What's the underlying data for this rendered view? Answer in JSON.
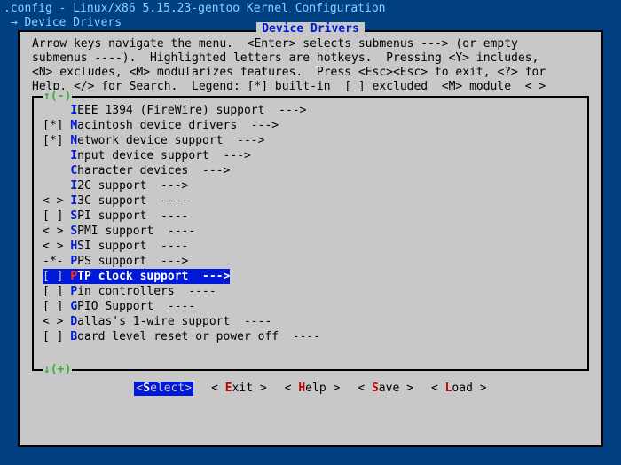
{
  "header": {
    "line1": ".config - Linux/x86 5.15.23-gentoo Kernel Configuration",
    "line2": " → Device Drivers"
  },
  "window": {
    "title": "Device Drivers",
    "help_text": "Arrow keys navigate the menu.  <Enter> selects submenus ---> (or empty\nsubmenus ----).  Highlighted letters are hotkeys.  Pressing <Y> includes,\n<N> excludes, <M> modularizes features.  Press <Esc><Esc> to exit, <?> for\nHelp, </> for Search.  Legend: [*] built-in  [ ] excluded  <M> module  < >",
    "scroll_up": "↑(-)",
    "scroll_down": "↓(+)"
  },
  "items": [
    {
      "mark": "   ",
      "hot": "I",
      "rest": "EEE 1394 (FireWire) support  --->",
      "sel": false
    },
    {
      "mark": "[*]",
      "hot": "M",
      "rest": "acintosh device drivers  --->",
      "sel": false
    },
    {
      "mark": "[*]",
      "hot": "N",
      "rest": "etwork device support  --->",
      "sel": false
    },
    {
      "mark": "   ",
      "hot": "I",
      "rest": "nput device support  --->",
      "sel": false
    },
    {
      "mark": "   ",
      "hot": "C",
      "rest": "haracter devices  --->",
      "sel": false
    },
    {
      "mark": "   ",
      "hot": "I",
      "rest": "2C support  --->",
      "sel": false
    },
    {
      "mark": "< >",
      "hot": "I",
      "rest": "3C support  ----",
      "sel": false
    },
    {
      "mark": "[ ]",
      "hot": "S",
      "rest": "PI support  ----",
      "sel": false
    },
    {
      "mark": "< >",
      "hot": "S",
      "rest": "PMI support  ----",
      "sel": false
    },
    {
      "mark": "< >",
      "hot": "H",
      "rest": "SI support  ----",
      "sel": false
    },
    {
      "mark": "-*-",
      "hot": "P",
      "rest": "PS support  --->",
      "sel": false
    },
    {
      "mark": "[ ]",
      "hot": "P",
      "rest": "TP clock support  --->",
      "sel": true
    },
    {
      "mark": "[ ]",
      "hot": "P",
      "rest": "in controllers  ----",
      "sel": false
    },
    {
      "mark": "[ ]",
      "hot": "G",
      "rest": "PIO Support  ----",
      "sel": false
    },
    {
      "mark": "< >",
      "hot": "D",
      "rest": "allas's 1-wire support  ----",
      "sel": false
    },
    {
      "mark": "[ ]",
      "hot": "B",
      "rest": "oard level reset or power off  ----",
      "sel": false
    }
  ],
  "buttons": [
    {
      "pre": "<",
      "hot": "S",
      "post": "elect>",
      "sel": true
    },
    {
      "pre": "< ",
      "hot": "E",
      "post": "xit >",
      "sel": false
    },
    {
      "pre": "< ",
      "hot": "H",
      "post": "elp >",
      "sel": false
    },
    {
      "pre": "< ",
      "hot": "S",
      "post": "ave >",
      "sel": false
    },
    {
      "pre": "< ",
      "hot": "L",
      "post": "oad >",
      "sel": false
    }
  ]
}
